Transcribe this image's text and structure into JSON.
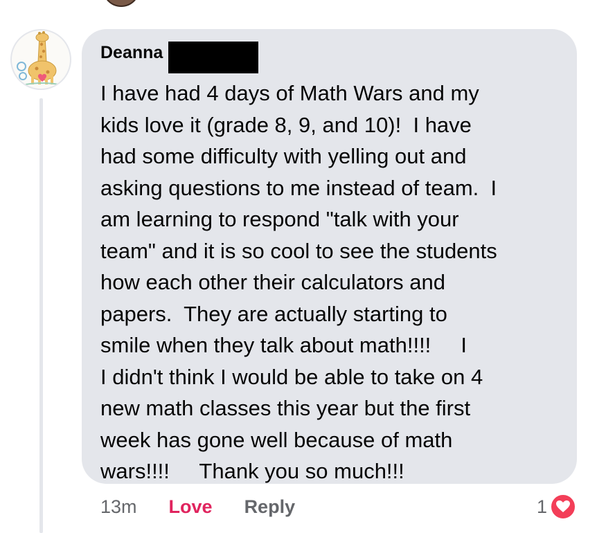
{
  "comment": {
    "author": "Deanna",
    "lines": [
      "I have had 4 days of Math Wars and my",
      "kids love it (grade 8, 9, and 10)!  I have",
      "had some difficulty with yelling out and",
      "asking questions to me instead of team.  I",
      "am learning to respond \"talk with your",
      "team\" and it is so cool to see the students",
      "how each other their calculators and",
      "papers.  They are actually starting to",
      "smile when they talk about math!!!!     I",
      "I didn't think I would be able to take on 4",
      "new math classes this year but the first",
      "week has gone well because of math",
      "wars!!!!     Thank you so much!!!"
    ]
  },
  "actions": {
    "time": "13m",
    "love_label": "Love",
    "reply_label": "Reply"
  },
  "reactions": {
    "count": "1",
    "icon": "heart-icon",
    "color": "#f33e58"
  },
  "colors": {
    "bubble": "#e4e6eb",
    "love_accent": "#e0245e",
    "muted_text": "#65676b"
  }
}
